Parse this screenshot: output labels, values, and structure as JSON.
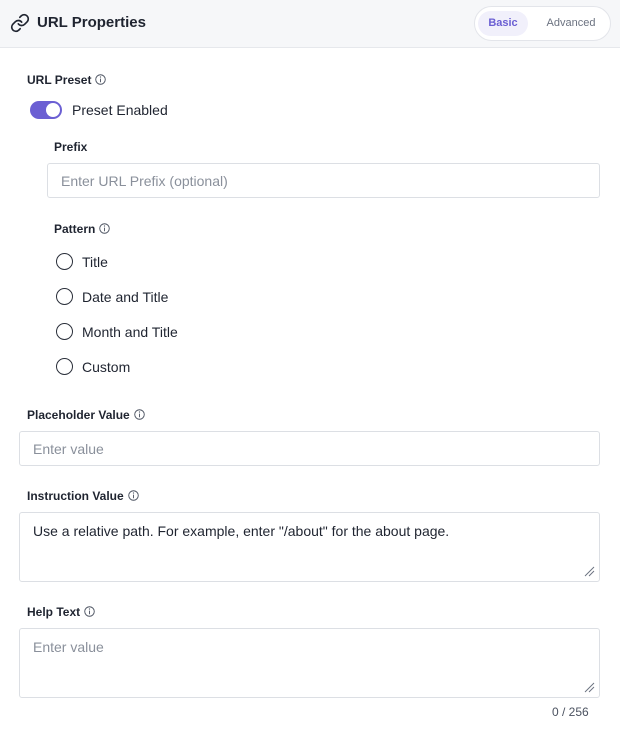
{
  "header": {
    "title": "URL Properties",
    "tabs": [
      {
        "label": "Basic",
        "active": true
      },
      {
        "label": "Advanced",
        "active": false
      }
    ]
  },
  "url_preset": {
    "label": "URL Preset",
    "toggle": {
      "label": "Preset Enabled",
      "on": true
    },
    "prefix": {
      "label": "Prefix",
      "placeholder": "Enter URL Prefix (optional)",
      "value": ""
    },
    "pattern": {
      "label": "Pattern",
      "options": [
        "Title",
        "Date and Title",
        "Month and Title",
        "Custom"
      ]
    }
  },
  "placeholder_value": {
    "label": "Placeholder Value",
    "placeholder": "Enter value",
    "value": ""
  },
  "instruction_value": {
    "label": "Instruction Value",
    "value": "Use a relative path. For example, enter \"/about\" for the about page."
  },
  "help_text": {
    "label": "Help Text",
    "placeholder": "Enter value",
    "value": "",
    "counter": "0 / 256"
  },
  "colors": {
    "accent": "#6b5fd3",
    "accent_bg": "#f1f0fb",
    "border": "#dcdfe4",
    "header_bg": "#f6f7f9"
  }
}
